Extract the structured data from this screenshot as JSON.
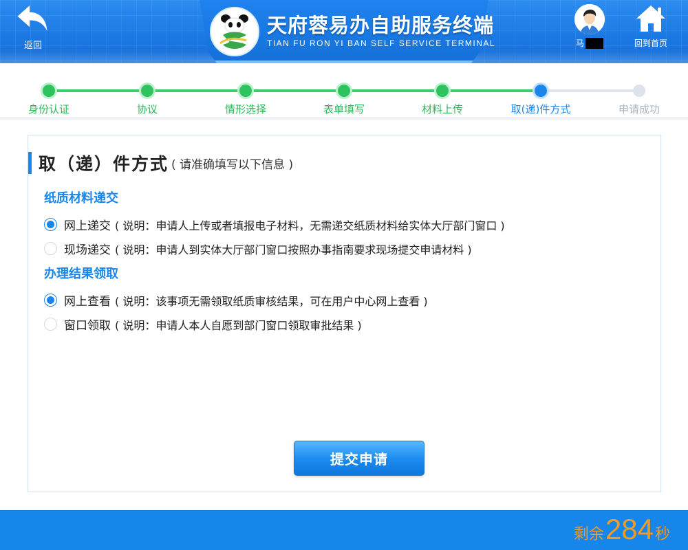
{
  "header": {
    "back_label": "返回",
    "title": "天府蓉易办自助服务终端",
    "subtitle": "TIAN FU RON YI BAN SELF SERVICE TERMINAL",
    "user_name_prefix": "马",
    "home_label": "回到首页",
    "logo_text": "易"
  },
  "steps": [
    {
      "label": "身份认证",
      "state": "done"
    },
    {
      "label": "协议",
      "state": "done"
    },
    {
      "label": "情形选择",
      "state": "done"
    },
    {
      "label": "表单填写",
      "state": "done"
    },
    {
      "label": "材料上传",
      "state": "done"
    },
    {
      "label": "取(递)件方式",
      "state": "current"
    },
    {
      "label": "申请成功",
      "state": "todo"
    }
  ],
  "form": {
    "title": "取（递）件方式",
    "hint": "( 请准确填写以下信息 )",
    "groups": [
      {
        "title": "纸质材料递交",
        "options": [
          {
            "label": "网上递交",
            "desc": "( 说明：申请人上传或者填报电子材料，无需递交纸质材料给实体大厅部门窗口 )",
            "checked": true
          },
          {
            "label": "现场递交",
            "desc": "( 说明：申请人到实体大厅部门窗口按照办事指南要求现场提交申请材料 )",
            "checked": false
          }
        ]
      },
      {
        "title": "办理结果领取",
        "options": [
          {
            "label": "网上查看",
            "desc": "( 说明：该事项无需领取纸质审核结果，可在用户中心网上查看 )",
            "checked": true
          },
          {
            "label": "窗口领取",
            "desc": "( 说明：申请人本人自愿到部门窗口领取审批结果 )",
            "checked": false
          }
        ]
      }
    ],
    "submit_label": "提交申请"
  },
  "footer": {
    "countdown_prefix": "剩余",
    "countdown_value": "284",
    "countdown_suffix": "秒"
  },
  "colors": {
    "primary": "#1a86ea",
    "done_green": "#2fc35f",
    "countdown_orange": "#f59a23"
  }
}
